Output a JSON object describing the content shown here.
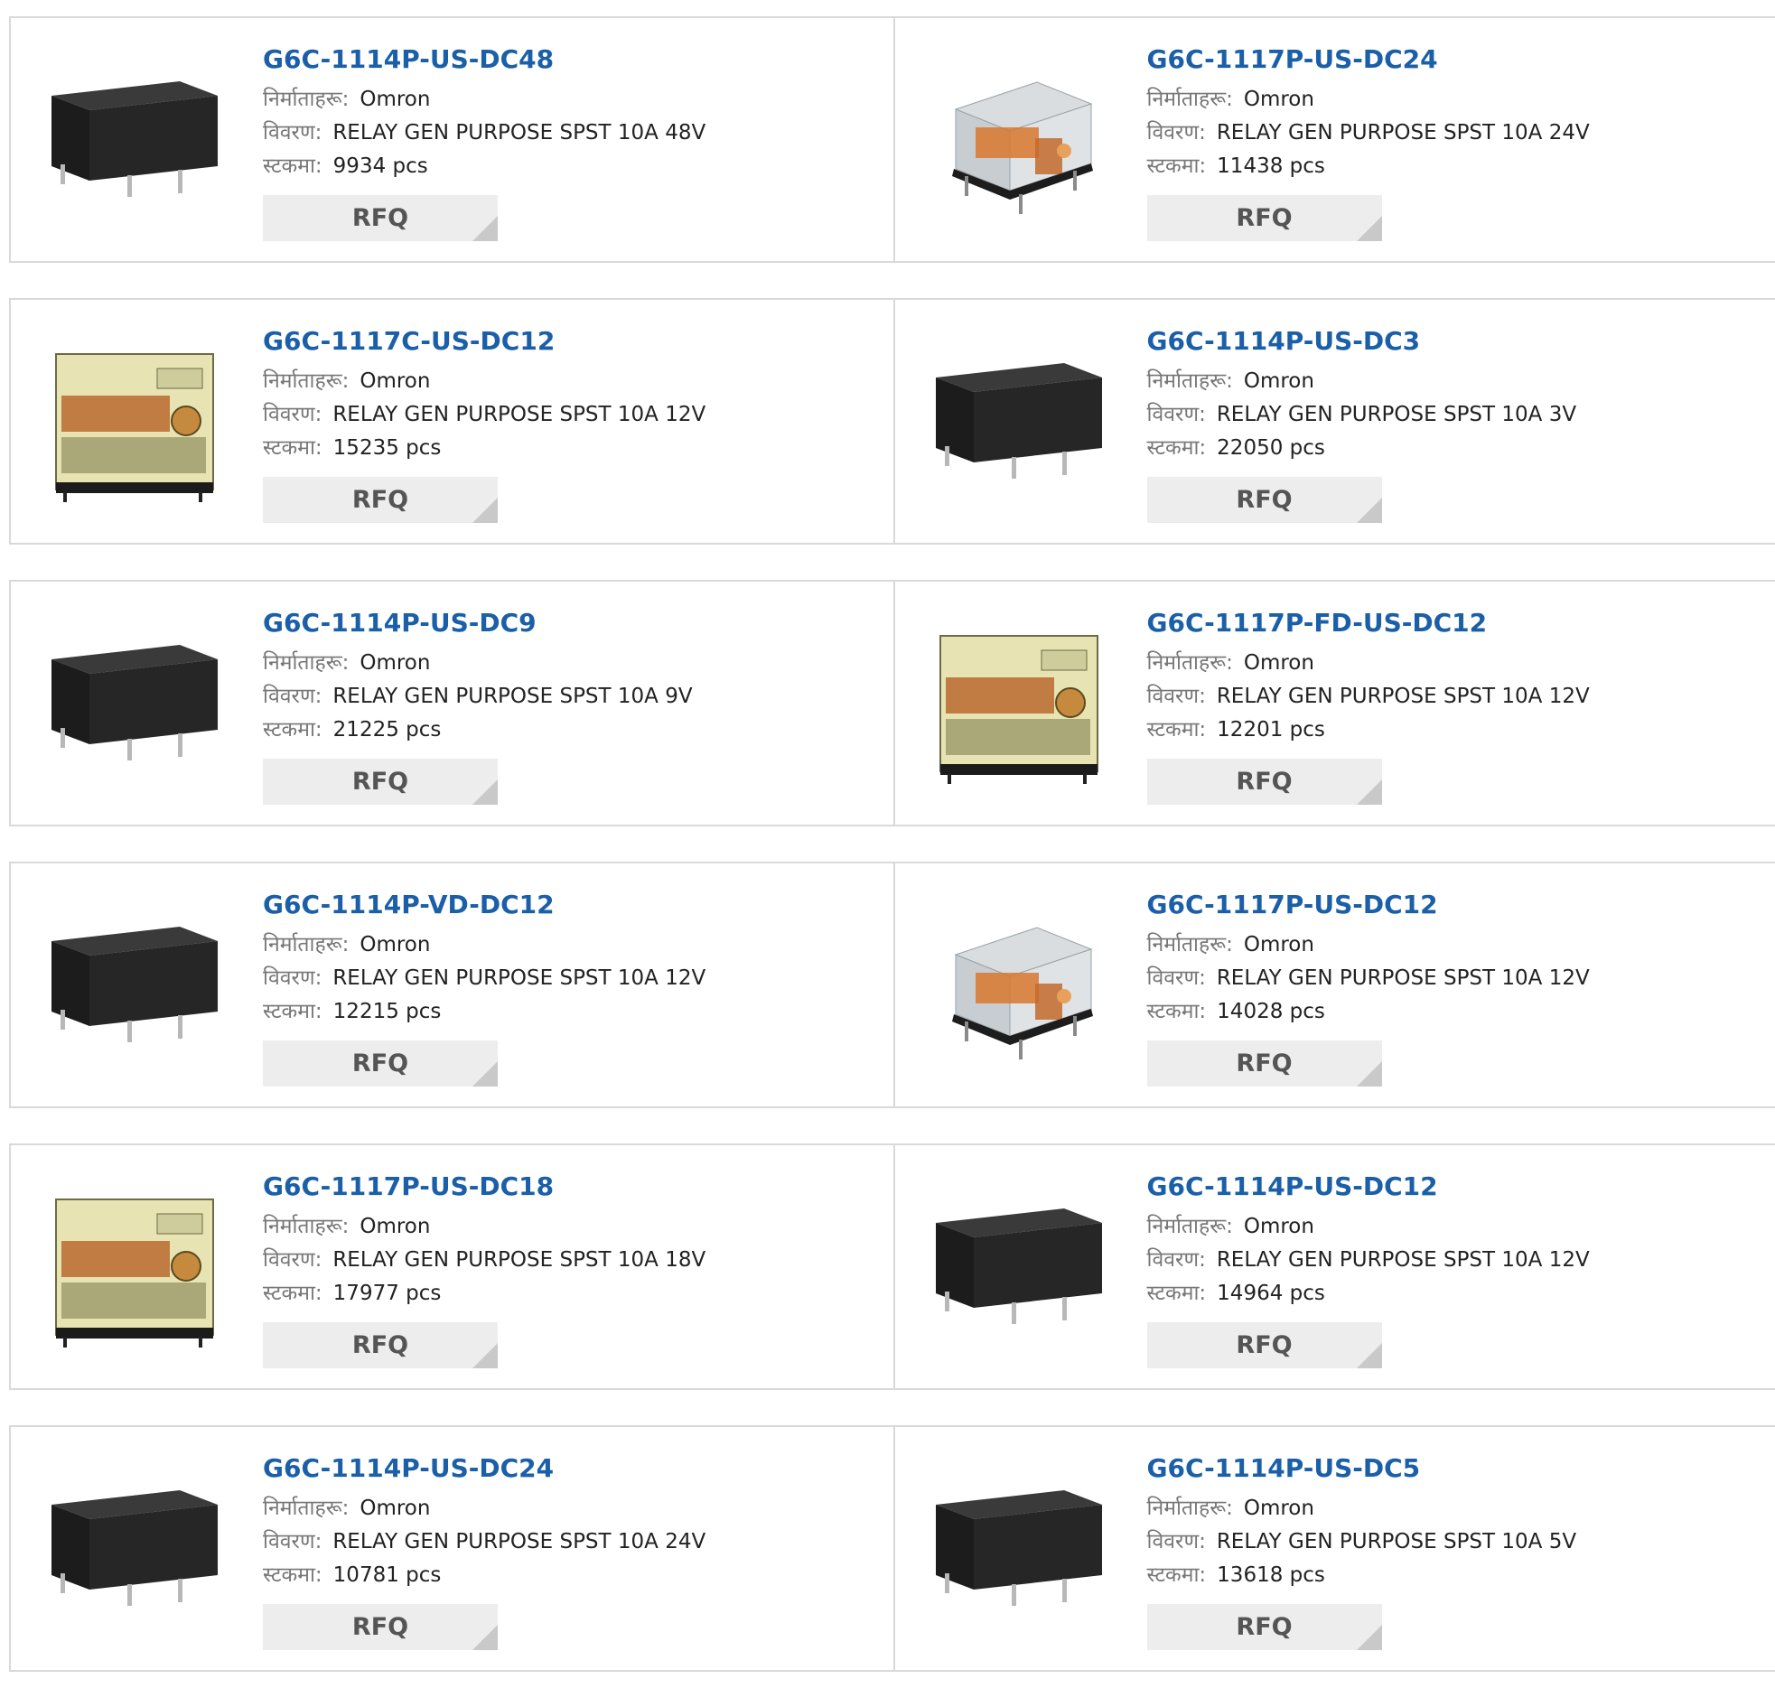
{
  "labels": {
    "manufacturer": "निर्माताहरू:",
    "description": "विवरण:",
    "stock": "स्टकमा:",
    "rfq": "RFQ"
  },
  "products": [
    {
      "part": "G6C-1114P-US-DC48",
      "manufacturer": "Omron",
      "description": "RELAY GEN PURPOSE SPST 10A 48V",
      "stock": "9934 pcs",
      "image": "black-relay"
    },
    {
      "part": "G6C-1117P-US-DC24",
      "manufacturer": "Omron",
      "description": "RELAY GEN PURPOSE SPST 10A 24V",
      "stock": "11438 pcs",
      "image": "clear-relay"
    },
    {
      "part": "G6C-1117C-US-DC12",
      "manufacturer": "Omron",
      "description": "RELAY GEN PURPOSE SPST 10A 12V",
      "stock": "15235 pcs",
      "image": "clear-relay-front"
    },
    {
      "part": "G6C-1114P-US-DC3",
      "manufacturer": "Omron",
      "description": "RELAY GEN PURPOSE SPST 10A 3V",
      "stock": "22050 pcs",
      "image": "black-relay"
    },
    {
      "part": "G6C-1114P-US-DC9",
      "manufacturer": "Omron",
      "description": "RELAY GEN PURPOSE SPST 10A 9V",
      "stock": "21225 pcs",
      "image": "black-relay"
    },
    {
      "part": "G6C-1117P-FD-US-DC12",
      "manufacturer": "Omron",
      "description": "RELAY GEN PURPOSE SPST 10A 12V",
      "stock": "12201 pcs",
      "image": "clear-relay-front"
    },
    {
      "part": "G6C-1114P-VD-DC12",
      "manufacturer": "Omron",
      "description": "RELAY GEN PURPOSE SPST 10A 12V",
      "stock": "12215 pcs",
      "image": "black-relay"
    },
    {
      "part": "G6C-1117P-US-DC12",
      "manufacturer": "Omron",
      "description": "RELAY GEN PURPOSE SPST 10A 12V",
      "stock": "14028 pcs",
      "image": "clear-relay"
    },
    {
      "part": "G6C-1117P-US-DC18",
      "manufacturer": "Omron",
      "description": "RELAY GEN PURPOSE SPST 10A 18V",
      "stock": "17977 pcs",
      "image": "clear-relay-front"
    },
    {
      "part": "G6C-1114P-US-DC12",
      "manufacturer": "Omron",
      "description": "RELAY GEN PURPOSE SPST 10A 12V",
      "stock": "14964 pcs",
      "image": "black-relay"
    },
    {
      "part": "G6C-1114P-US-DC24",
      "manufacturer": "Omron",
      "description": "RELAY GEN PURPOSE SPST 10A 24V",
      "stock": "10781 pcs",
      "image": "black-relay"
    },
    {
      "part": "G6C-1114P-US-DC5",
      "manufacturer": "Omron",
      "description": "RELAY GEN PURPOSE SPST 10A 5V",
      "stock": "13618 pcs",
      "image": "black-relay"
    }
  ],
  "colors": {
    "link": "#1a5fa8",
    "label": "#777777",
    "button_bg": "#ededed",
    "border": "#d9d9d9"
  }
}
